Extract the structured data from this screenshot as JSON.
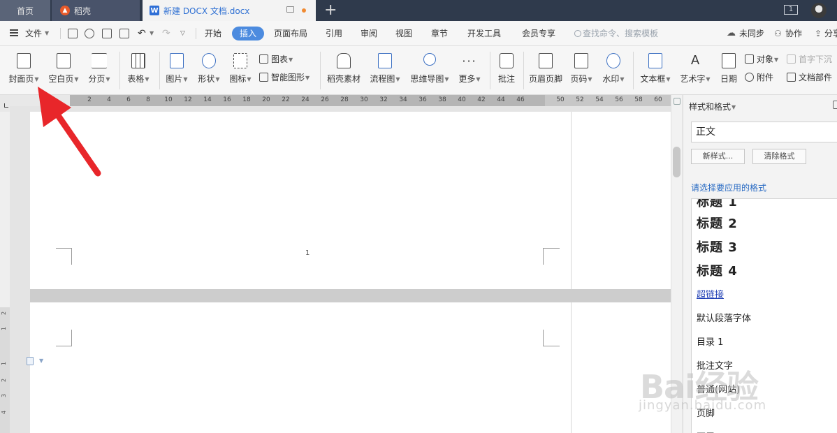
{
  "titlebar": {
    "tab_home": "首页",
    "tab_daoke": "稻壳",
    "tab_doc": "新建 DOCX 文档.docx",
    "new_tab": "+",
    "window_badge": "1"
  },
  "menubar": {
    "file": "文件",
    "tabs": [
      "开始",
      "插入",
      "页面布局",
      "引用",
      "审阅",
      "视图",
      "章节",
      "开发工具",
      "会员专享"
    ],
    "active_tab": "插入",
    "search_placeholder": "查找命令、搜索模板",
    "sync": "未同步",
    "collab": "协作",
    "share": "分享"
  },
  "ribbon": {
    "cover": "封面页",
    "blank": "空白页",
    "pagebreak": "分页",
    "table": "表格",
    "picture": "图片",
    "shape": "形状",
    "icon": "图标",
    "chart": "图表",
    "smartart": "智能图形",
    "daoke_material": "稻壳素材",
    "flowchart": "流程图",
    "mindmap": "思维导图",
    "more": "更多",
    "comment": "批注",
    "header_footer": "页眉页脚",
    "page_number": "页码",
    "watermark": "水印",
    "textbox": "文本框",
    "wordart": "艺术字",
    "date": "日期",
    "object": "对象",
    "dropcap": "首字下沉",
    "attachment": "附件",
    "doc_parts": "文档部件"
  },
  "ruler": {
    "ticks": [
      "2",
      "4",
      "6",
      "8",
      "10",
      "12",
      "14",
      "16",
      "18",
      "20",
      "22",
      "24",
      "26",
      "28",
      "30",
      "32",
      "34",
      "36",
      "38",
      "40",
      "42",
      "44",
      "46",
      "50",
      "52",
      "54",
      "56",
      "58",
      "60"
    ]
  },
  "vruler": [
    "2",
    "1",
    "1",
    "2",
    "3",
    "4"
  ],
  "document": {
    "page_number": "1"
  },
  "panel": {
    "title": "样式和格式",
    "current_style": "正文",
    "new_style_btn": "新样式...",
    "clear_format_btn": "清除格式",
    "choose_label": "请选择要应用的格式",
    "styles": {
      "h1": "标题 1",
      "h2": "标题 2",
      "h3": "标题 3",
      "h4": "标题 4",
      "hyperlink": "超链接",
      "default_font": "默认段落字体",
      "toc1": "目录 1",
      "comment_text": "批注文字",
      "normal_web": "普通(网站)",
      "footer": "页脚",
      "header": "页眉"
    }
  },
  "watermark": {
    "brand": "Bai经验",
    "url": "jingyan.baidu.com"
  },
  "colors": {
    "titlebar": "#2f3a4c",
    "accent": "#4c8bdf",
    "arrow": "#e8262a"
  }
}
